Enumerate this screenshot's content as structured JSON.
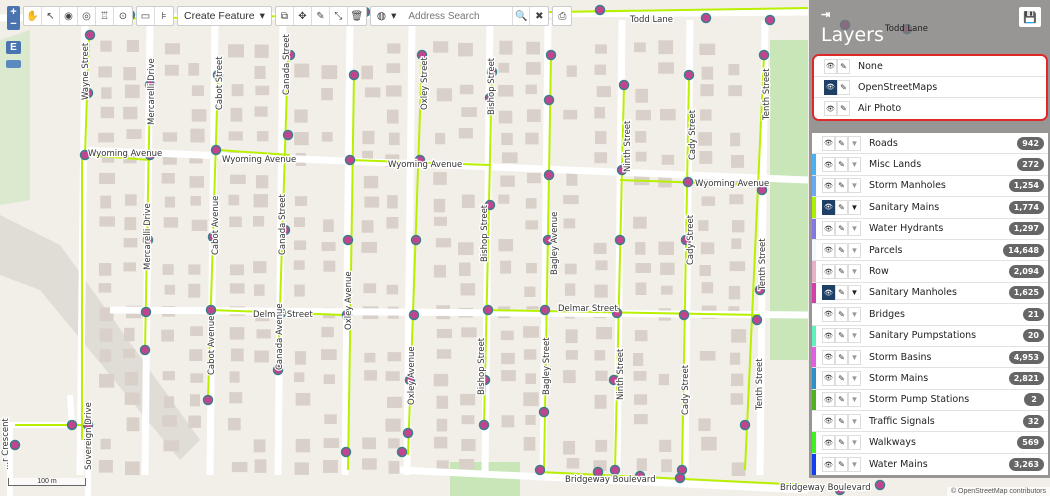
{
  "map": {
    "zoom_in": "+",
    "zoom_out": "−",
    "edit_mode_label": "E",
    "streets": {
      "todd_lane": "Todd Lane",
      "todd_lane_2": "Todd Lane",
      "wyoming_1": "Wyoming Avenue",
      "wyoming_2": "Wyoming Avenue",
      "wyoming_3": "Wyoming Avenue",
      "wyoming_4": "Wyoming Avenue",
      "delmar_1": "Delmar Street",
      "delmar_2": "Delmar Street",
      "bridgeway_1": "Bridgeway Boulevard",
      "bridgeway_2": "Bridgeway Boulevard",
      "wayne": "Wayne Street",
      "mercarelli_1": "Mercarelli Drive",
      "mercarelli_2": "Mercarelli Drive",
      "cabot_1": "Cabot Street",
      "cabot_2": "Cabot Avenue",
      "cabot_3": "Cabot Avenue",
      "canada_1": "Canada Street",
      "canada_2": "Canada Street",
      "canada_3": "Canada Avenue",
      "oxley_1": "Oxley Street",
      "oxley_2": "Oxley Avenue",
      "oxley_3": "Oxley Avenue",
      "bishop_1": "Bishop Street",
      "bishop_2": "Bishop Street",
      "bishop_3": "Bishop Street",
      "bagley_1": "Bagley Avenue",
      "bagley_2": "Bagley Street",
      "ninth_1": "Ninth Street",
      "ninth_2": "Ninth Street",
      "cady_1": "Cady Street",
      "cady_2": "Cady Street",
      "cady_3": "Cady Street",
      "tenth_1": "Tenth Street",
      "tenth_2": "Tenth Street",
      "tenth_3": "Tenth Street",
      "crescent": "...r Crescent",
      "sovereign": "Sovereign Drive"
    },
    "scale_label": "100 m",
    "attribution": "© OpenStreetMap contributors",
    "colors": {
      "background": "#f2efe9",
      "street": "#ffffff",
      "sanitary_main": "#b8f000",
      "manhole": "#c2448f",
      "manhole_ring": "#3a7f8a",
      "building": "#d9d0c9",
      "park": "#c8e6b8"
    }
  },
  "toolbar": {
    "tools": [
      "hand-icon",
      "pointer-icon",
      "identify-icon",
      "select-area-icon",
      "select-feature-icon",
      "buffer-icon",
      "measure-line-icon",
      "measure-area-icon"
    ],
    "create_feature_label": "Create Feature",
    "edit_tools": [
      "copy-icon",
      "move-icon",
      "edit-icon",
      "resize-icon",
      "trash-icon"
    ],
    "globe_icon": "globe-icon",
    "search_placeholder": "Address Search",
    "search_icon": "search-icon",
    "clear_icon": "close-icon",
    "print_icon": "print-icon"
  },
  "panel": {
    "title": "Layers",
    "collapse_icon": "collapse-icon",
    "save_icon": "save-icon",
    "base_layers": [
      {
        "label": "None",
        "visible": false
      },
      {
        "label": "OpenStreetMaps",
        "visible": true
      },
      {
        "label": "Air Photo",
        "visible": false
      }
    ],
    "layers": [
      {
        "label": "Roads",
        "count": "942",
        "color": "#ffffff",
        "visible": false
      },
      {
        "label": "Misc Lands",
        "count": "272",
        "color": "#4ab0f0",
        "visible": false
      },
      {
        "label": "Storm Manholes",
        "count": "1,254",
        "color": "#6aa8f0",
        "visible": false
      },
      {
        "label": "Sanitary Mains",
        "count": "1,774",
        "color": "#a8f000",
        "visible": true
      },
      {
        "label": "Water Hydrants",
        "count": "1,297",
        "color": "#8478e0",
        "visible": false
      },
      {
        "label": "Parcels",
        "count": "14,648",
        "color": "#f4f8fc",
        "visible": false
      },
      {
        "label": "Row",
        "count": "2,094",
        "color": "#e8b0c4",
        "visible": false
      },
      {
        "label": "Sanitary Manholes",
        "count": "1,625",
        "color": "#d040a8",
        "visible": true
      },
      {
        "label": "Bridges",
        "count": "21",
        "color": "#ffffff",
        "visible": false
      },
      {
        "label": "Sanitary Pumpstations",
        "count": "20",
        "color": "#60f0c0",
        "visible": false
      },
      {
        "label": "Storm Basins",
        "count": "4,953",
        "color": "#e060e0",
        "visible": false
      },
      {
        "label": "Storm Mains",
        "count": "2,821",
        "color": "#3090c8",
        "visible": false
      },
      {
        "label": "Storm Pump Stations",
        "count": "2",
        "color": "#50b020",
        "visible": false
      },
      {
        "label": "Traffic Signals",
        "count": "32",
        "color": "#ffffff",
        "visible": false
      },
      {
        "label": "Walkways",
        "count": "569",
        "color": "#40f020",
        "visible": false
      },
      {
        "label": "Water Mains",
        "count": "3,263",
        "color": "#1040f0",
        "visible": false
      }
    ]
  }
}
